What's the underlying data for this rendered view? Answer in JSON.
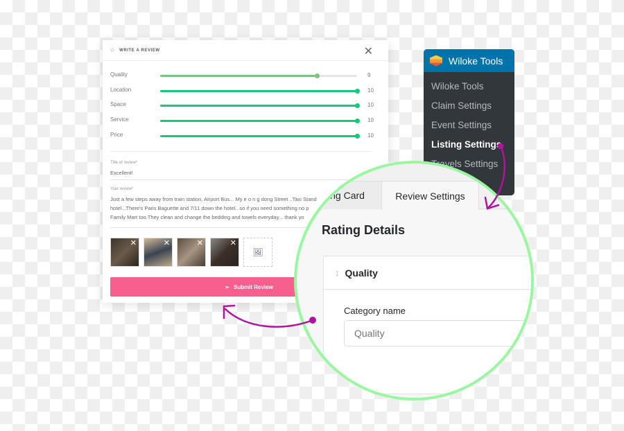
{
  "review_modal": {
    "title": "WRITE A REVIEW",
    "ratings": [
      {
        "label": "Quality",
        "value": 9,
        "max": 10
      },
      {
        "label": "Location",
        "value": 10,
        "max": 10
      },
      {
        "label": "Space",
        "value": 10,
        "max": 10
      },
      {
        "label": "Service",
        "value": 10,
        "max": 10
      },
      {
        "label": "Price",
        "value": 10,
        "max": 10
      }
    ],
    "title_label": "Title of review*",
    "title_value": "Excellent!",
    "review_label": "Your review*",
    "review_lines": [
      "Just a few steps away from train station, Airport Bus... My e o n g dong Street ..Taxi Stand",
      "hotel...There's Paris Baguette and 7/11 down the hotel.. so if you need something no p",
      "Family Mart too.They clean and change the bedding and towels everyday... thank yo"
    ],
    "submit_label": "Submit Review",
    "colors": {
      "quality": "#7cc47a",
      "full": "#13c97a",
      "submit": "#f75f8f"
    }
  },
  "admin_menu": {
    "title": "Wiloke Tools",
    "items": [
      "Wiloke Tools",
      "Claim Settings",
      "Event Settings",
      "Listing Settings",
      "Travels Settings"
    ],
    "active": "Listing Settings"
  },
  "zoom_panel": {
    "tabs": [
      "ing Card",
      "Review Settings"
    ],
    "active_tab": "Review Settings",
    "heading": "Rating Details",
    "item_title": "Quality",
    "field_label": "Category name",
    "field_value": "Quality"
  }
}
